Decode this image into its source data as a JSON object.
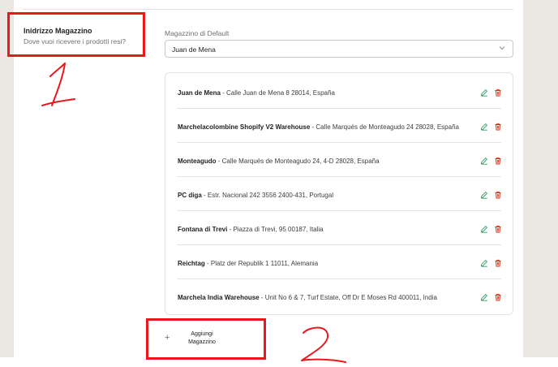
{
  "section": {
    "title": "Inidrizzo Magazzino",
    "subtitle": "Dove vuoi ricevere i prodotti resi?"
  },
  "default_warehouse": {
    "label": "Magazzino di Default",
    "value": "Juan de Mena"
  },
  "warehouses": [
    {
      "name": "Juan de Mena",
      "address": " - Calle Juan de Mena 8 28014, España"
    },
    {
      "name": "Marchelacolombine Shopify V2 Warehouse",
      "address": " - Calle Marqués de Monteagudo 24 28028, España"
    },
    {
      "name": "Monteagudo",
      "address": " - Calle Marqués de Monteagudo 24, 4-D 28028, España"
    },
    {
      "name": "PC diga",
      "address": " - Estr. Nacional 242 3556 2400-431, Portugal"
    },
    {
      "name": "Fontana di Trevi",
      "address": " - Piazza di Trevi, 95 00187, Italia"
    },
    {
      "name": "Reichtag",
      "address": " - Platz der Republik 1 11011, Alemania"
    },
    {
      "name": "Marchela India Warehouse",
      "address": " - Unit No 6 & 7, Turf Estate, Off Dr E Moses Rd 400011, India"
    }
  ],
  "add_button": {
    "plus": "+",
    "label_line1": "Aggiungi",
    "label_line2": "Magazzino"
  },
  "annotations": {
    "marker1": "1",
    "marker2": "2",
    "color": "#e8191c"
  },
  "icons": {
    "edit": "pencil-icon",
    "delete": "trash-icon",
    "select": "chevron-down-icon",
    "edit_color": "#2e9e5b",
    "delete_color": "#d82c0d"
  }
}
